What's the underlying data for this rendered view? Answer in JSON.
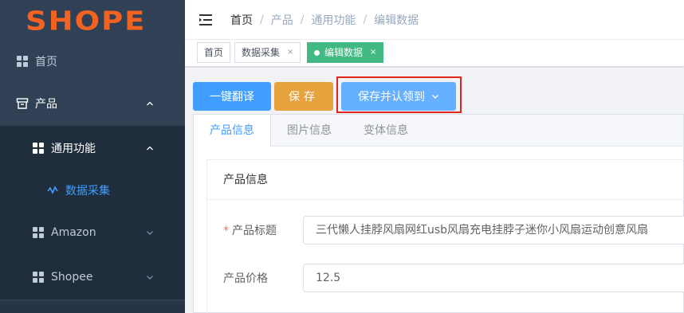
{
  "logo": {
    "text": "SHOPE",
    "color": "#f26322"
  },
  "sidebar": {
    "items": [
      {
        "label": "首页",
        "icon": "grid-icon"
      },
      {
        "label": "产品",
        "icon": "box-icon",
        "expanded": true
      },
      {
        "label": "通用功能",
        "icon": "grid-icon",
        "expanded": true
      },
      {
        "label": "数据采集",
        "icon": "pulse-icon",
        "active": true
      },
      {
        "label": "Amazon",
        "icon": "grid-icon",
        "expanded": false
      },
      {
        "label": "Shopee",
        "icon": "grid-icon",
        "expanded": false
      }
    ]
  },
  "navbar": {
    "breadcrumb": [
      "首页",
      "产品",
      "通用功能",
      "编辑数据"
    ],
    "separator": "/"
  },
  "tags": [
    {
      "label": "首页",
      "closable": false
    },
    {
      "label": "数据采集",
      "closable": true
    },
    {
      "label": "编辑数据",
      "closable": true,
      "active": true
    }
  ],
  "tag_close": "×",
  "toolbar": {
    "translate_label": "一键翻译",
    "save_label": "保存",
    "save_claim_label": "保存并认领到"
  },
  "tabs": [
    "产品信息",
    "图片信息",
    "变体信息"
  ],
  "form": {
    "section_title": "产品信息",
    "required_mark": "*",
    "title_label": "产品标题",
    "title_value": "三代懒人挂脖风扇网红usb风扇充电挂脖子迷你小风扇运动创意风扇",
    "price_label": "产品价格",
    "price_value": "12.5"
  },
  "colors": {
    "sidebar_bg": "#304156",
    "submenu_bg": "#1f2d3d",
    "primary": "#409eff",
    "warning": "#e6a23c",
    "tag_active": "#42b983",
    "highlight": "#e1251b"
  }
}
